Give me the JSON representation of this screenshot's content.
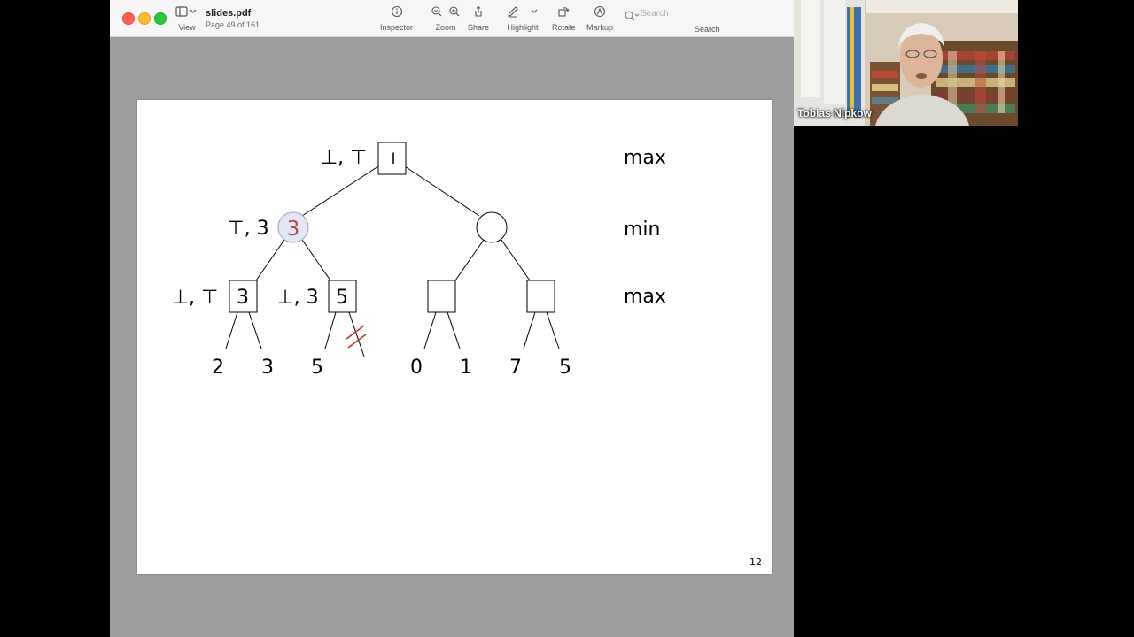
{
  "window": {
    "doc_name": "slides.pdf",
    "page_info": "Page 49 of 161"
  },
  "toolbar": {
    "view": {
      "label": "View",
      "icon": "sidebar-icon"
    },
    "inspector": {
      "label": "Inspector",
      "icon": "info-icon"
    },
    "zoom": {
      "label": "Zoom",
      "icon": "zoom-icon"
    },
    "share": {
      "label": "Share",
      "icon": "share-icon"
    },
    "highlight": {
      "label": "Highlight",
      "icon": "pen-icon"
    },
    "rotate": {
      "label": "Rotate",
      "icon": "rotate-icon"
    },
    "markup": {
      "label": "Markup",
      "icon": "markup-icon"
    },
    "search": {
      "label": "Search",
      "placeholder": "Search"
    }
  },
  "slide": {
    "labels": {
      "root": "⊥, ⊤",
      "min_left": "⊤, 3",
      "max_ll": "⊥, ⊤",
      "max_lr": "⊥, 3"
    },
    "node_values": {
      "min_left": "3",
      "max_ll": "3",
      "max_lr": "5"
    },
    "leaves": [
      "2",
      "3",
      "5",
      "0",
      "1",
      "7",
      "5"
    ],
    "level_labels": [
      "max",
      "min",
      "max"
    ],
    "page_number": "12",
    "annotation_color": "#c0392b"
  },
  "video": {
    "speaker_name": "Tobias Nipkow"
  }
}
